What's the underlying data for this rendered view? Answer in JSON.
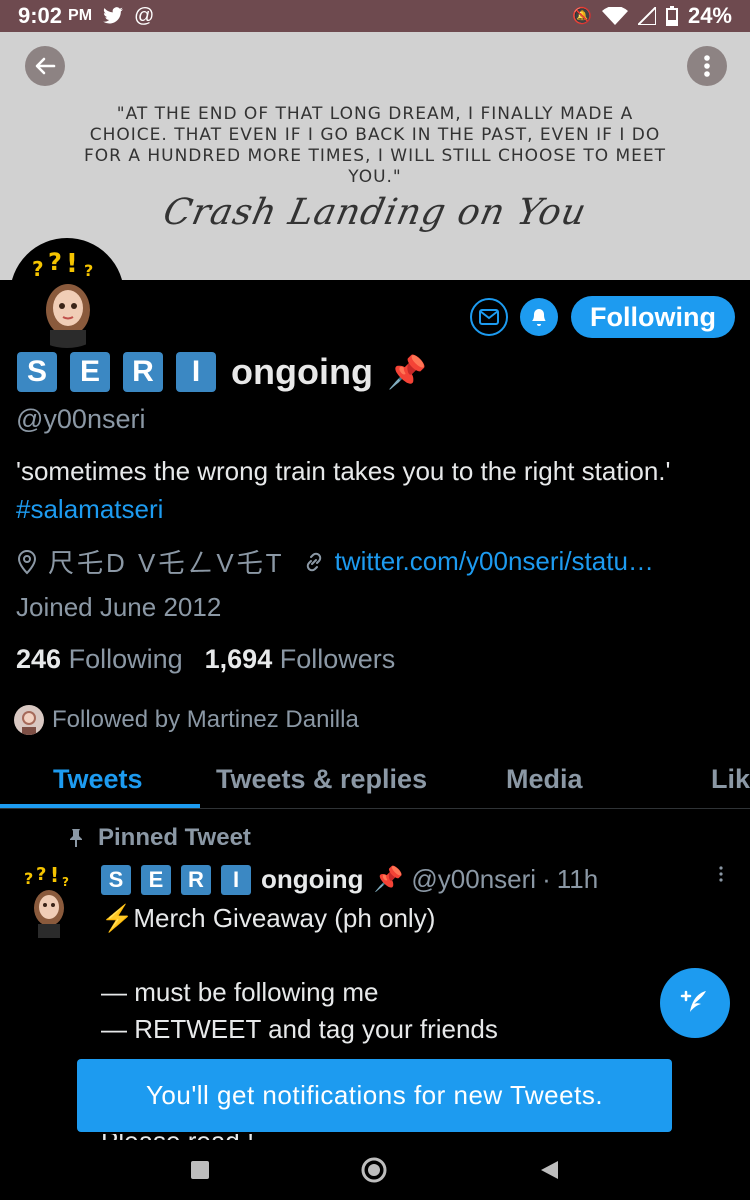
{
  "status_bar": {
    "time": "9:02",
    "ampm": "PM",
    "battery": "24%"
  },
  "banner": {
    "quote": "\"AT THE END OF THAT LONG DREAM, I FINALLY MADE A CHOICE. THAT EVEN IF I GO BACK IN THE PAST, EVEN IF I DO FOR A HUNDRED MORE TIMES, I WILL STILL CHOOSE TO MEET YOU.\"",
    "script_title": "Crash Landing on You"
  },
  "profile": {
    "name_letters": [
      "S",
      "E",
      "R",
      "I"
    ],
    "name_suffix": "ongoing",
    "handle": "@y00nseri",
    "bio_text": "'sometimes the wrong train takes you to the right station.'",
    "bio_hashtag": "#salamatseri",
    "location": "尺乇D V乇ㄥV乇T",
    "website": "twitter.com/y00nseri/statu…",
    "joined": "Joined June 2012",
    "following_count": "246",
    "following_label": "Following",
    "followers_count": "1,694",
    "followers_label": "Followers",
    "followed_by": "Followed by Martinez Danilla",
    "follow_button": "Following"
  },
  "tabs": [
    {
      "label": "Tweets",
      "active": true
    },
    {
      "label": "Tweets & replies",
      "active": false
    },
    {
      "label": "Media",
      "active": false
    },
    {
      "label": "Lik",
      "active": false
    }
  ],
  "tweet": {
    "pinned_label": "Pinned Tweet",
    "author_letters": [
      "S",
      "E",
      "R",
      "I"
    ],
    "author_suffix": "ongoing",
    "handle": "@y00nseri",
    "time": "11h",
    "body": "⚡Merch Giveaway (ph only)\n\n— must be following me\n— RETWEET and tag your friends",
    "peek": "Please read !"
  },
  "toast": "You'll get notifications for new Tweets.",
  "colors": {
    "accent": "#1d9bf0",
    "status_bar": "#6e4a4f",
    "banner": "#d1d1d1",
    "letter_box": "#3b88c3"
  },
  "icons": [
    "back-arrow-icon",
    "more-vertical-icon",
    "message-icon",
    "notification-bell-icon",
    "location-pin-icon",
    "link-icon",
    "pushpin-icon",
    "compose-tweet-icon",
    "nav-recents-icon",
    "nav-home-icon",
    "nav-back-icon"
  ]
}
